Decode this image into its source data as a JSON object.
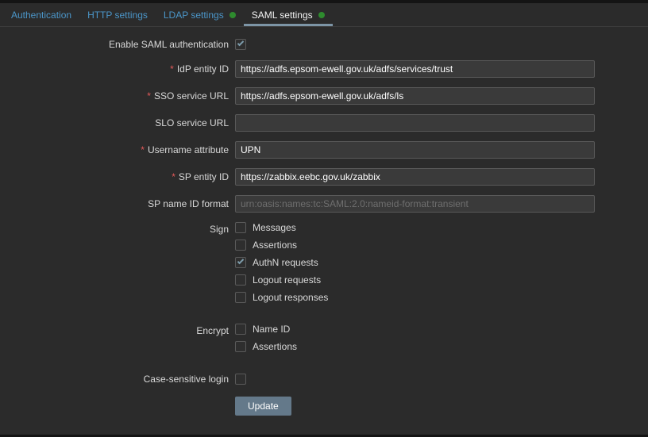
{
  "tabs": [
    {
      "label": "Authentication",
      "active": false,
      "dot": false
    },
    {
      "label": "HTTP settings",
      "active": false,
      "dot": false
    },
    {
      "label": "LDAP settings",
      "active": false,
      "dot": true
    },
    {
      "label": "SAML settings",
      "active": true,
      "dot": true
    }
  ],
  "form": {
    "enable": {
      "label": "Enable SAML authentication",
      "checked": true
    },
    "fields": [
      {
        "label": "IdP entity ID",
        "required": true,
        "value": "https://adfs.epsom-ewell.gov.uk/adfs/services/trust",
        "placeholder": ""
      },
      {
        "label": "SSO service URL",
        "required": true,
        "value": "https://adfs.epsom-ewell.gov.uk/adfs/ls",
        "placeholder": ""
      },
      {
        "label": "SLO service URL",
        "required": false,
        "value": "",
        "placeholder": ""
      },
      {
        "label": "Username attribute",
        "required": true,
        "value": "UPN",
        "placeholder": ""
      },
      {
        "label": "SP entity ID",
        "required": true,
        "value": "https://zabbix.eebc.gov.uk/zabbix",
        "placeholder": ""
      },
      {
        "label": "SP name ID format",
        "required": false,
        "value": "",
        "placeholder": "urn:oasis:names:tc:SAML:2.0:nameid-format:transient"
      }
    ],
    "groups": [
      {
        "label": "Sign",
        "options": [
          {
            "label": "Messages",
            "checked": false
          },
          {
            "label": "Assertions",
            "checked": false
          },
          {
            "label": "AuthN requests",
            "checked": true
          },
          {
            "label": "Logout requests",
            "checked": false
          },
          {
            "label": "Logout responses",
            "checked": false
          }
        ]
      },
      {
        "label": "Encrypt",
        "options": [
          {
            "label": "Name ID",
            "checked": false
          },
          {
            "label": "Assertions",
            "checked": false
          }
        ]
      }
    ],
    "case_sensitive": {
      "label": "Case-sensitive login",
      "checked": false
    },
    "update_button": "Update"
  },
  "colors": {
    "background": "#2b2b2b",
    "tab_link": "#4b96c9",
    "active_tab_text": "#f2f2f2",
    "active_underline": "#7d95a6",
    "status_green": "#2e8b2e",
    "required_red": "#e45959",
    "input_bg": "#3a3a3a",
    "input_border": "#595959",
    "checkmark": "#7d9cab",
    "button_bg": "#64798a"
  },
  "icons": {
    "status_dot": "status-dot-icon",
    "checkmark": "check-icon"
  }
}
